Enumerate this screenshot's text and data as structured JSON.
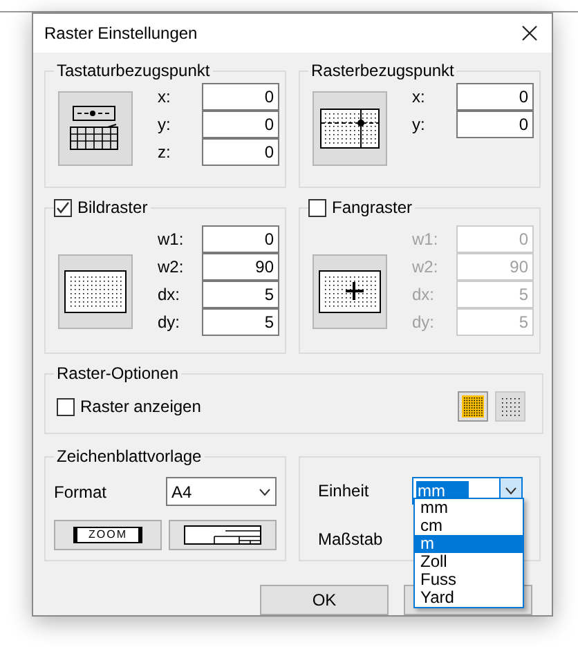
{
  "window": {
    "title": "Raster Einstellungen"
  },
  "keyboard_reference": {
    "title": "Tastaturbezugspunkt",
    "fields": [
      {
        "label": "x:",
        "value": "0"
      },
      {
        "label": "y:",
        "value": "0"
      },
      {
        "label": "z:",
        "value": "0"
      }
    ]
  },
  "grid_reference": {
    "title": "Rasterbezugspunkt",
    "fields": [
      {
        "label": "x:",
        "value": "0"
      },
      {
        "label": "y:",
        "value": "0"
      }
    ]
  },
  "image_grid": {
    "title": "Bildraster",
    "checked": true,
    "disabled": false,
    "fields": [
      {
        "label": "w1:",
        "value": "0"
      },
      {
        "label": "w2:",
        "value": "90"
      },
      {
        "label": "dx:",
        "value": "5"
      },
      {
        "label": "dy:",
        "value": "5"
      }
    ]
  },
  "snap_grid": {
    "title": "Fangraster",
    "checked": false,
    "disabled": true,
    "fields": [
      {
        "label": "w1:",
        "value": "0"
      },
      {
        "label": "w2:",
        "value": "90"
      },
      {
        "label": "dx:",
        "value": "5"
      },
      {
        "label": "dy:",
        "value": "5"
      }
    ]
  },
  "raster_options": {
    "title": "Raster-Optionen",
    "show_grid": {
      "label": "Raster anzeigen",
      "checked": false
    },
    "styles": [
      {
        "kind": "dense",
        "selected": true
      },
      {
        "kind": "sparse",
        "selected": false
      }
    ]
  },
  "sheet_template": {
    "title": "Zeichenblattvorlage",
    "format_label": "Format",
    "format_value": "A4",
    "zoom_label": "ZOOM"
  },
  "units": {
    "unit_label": "Einheit",
    "unit_value": "mm",
    "scale_label": "Maßstab",
    "options": [
      {
        "label": "mm",
        "selected": false
      },
      {
        "label": "cm",
        "selected": false
      },
      {
        "label": "m",
        "selected": true
      },
      {
        "label": "Zoll",
        "selected": false
      },
      {
        "label": "Fuss",
        "selected": false
      },
      {
        "label": "Yard",
        "selected": false
      }
    ]
  },
  "buttons": [
    "OK"
  ]
}
